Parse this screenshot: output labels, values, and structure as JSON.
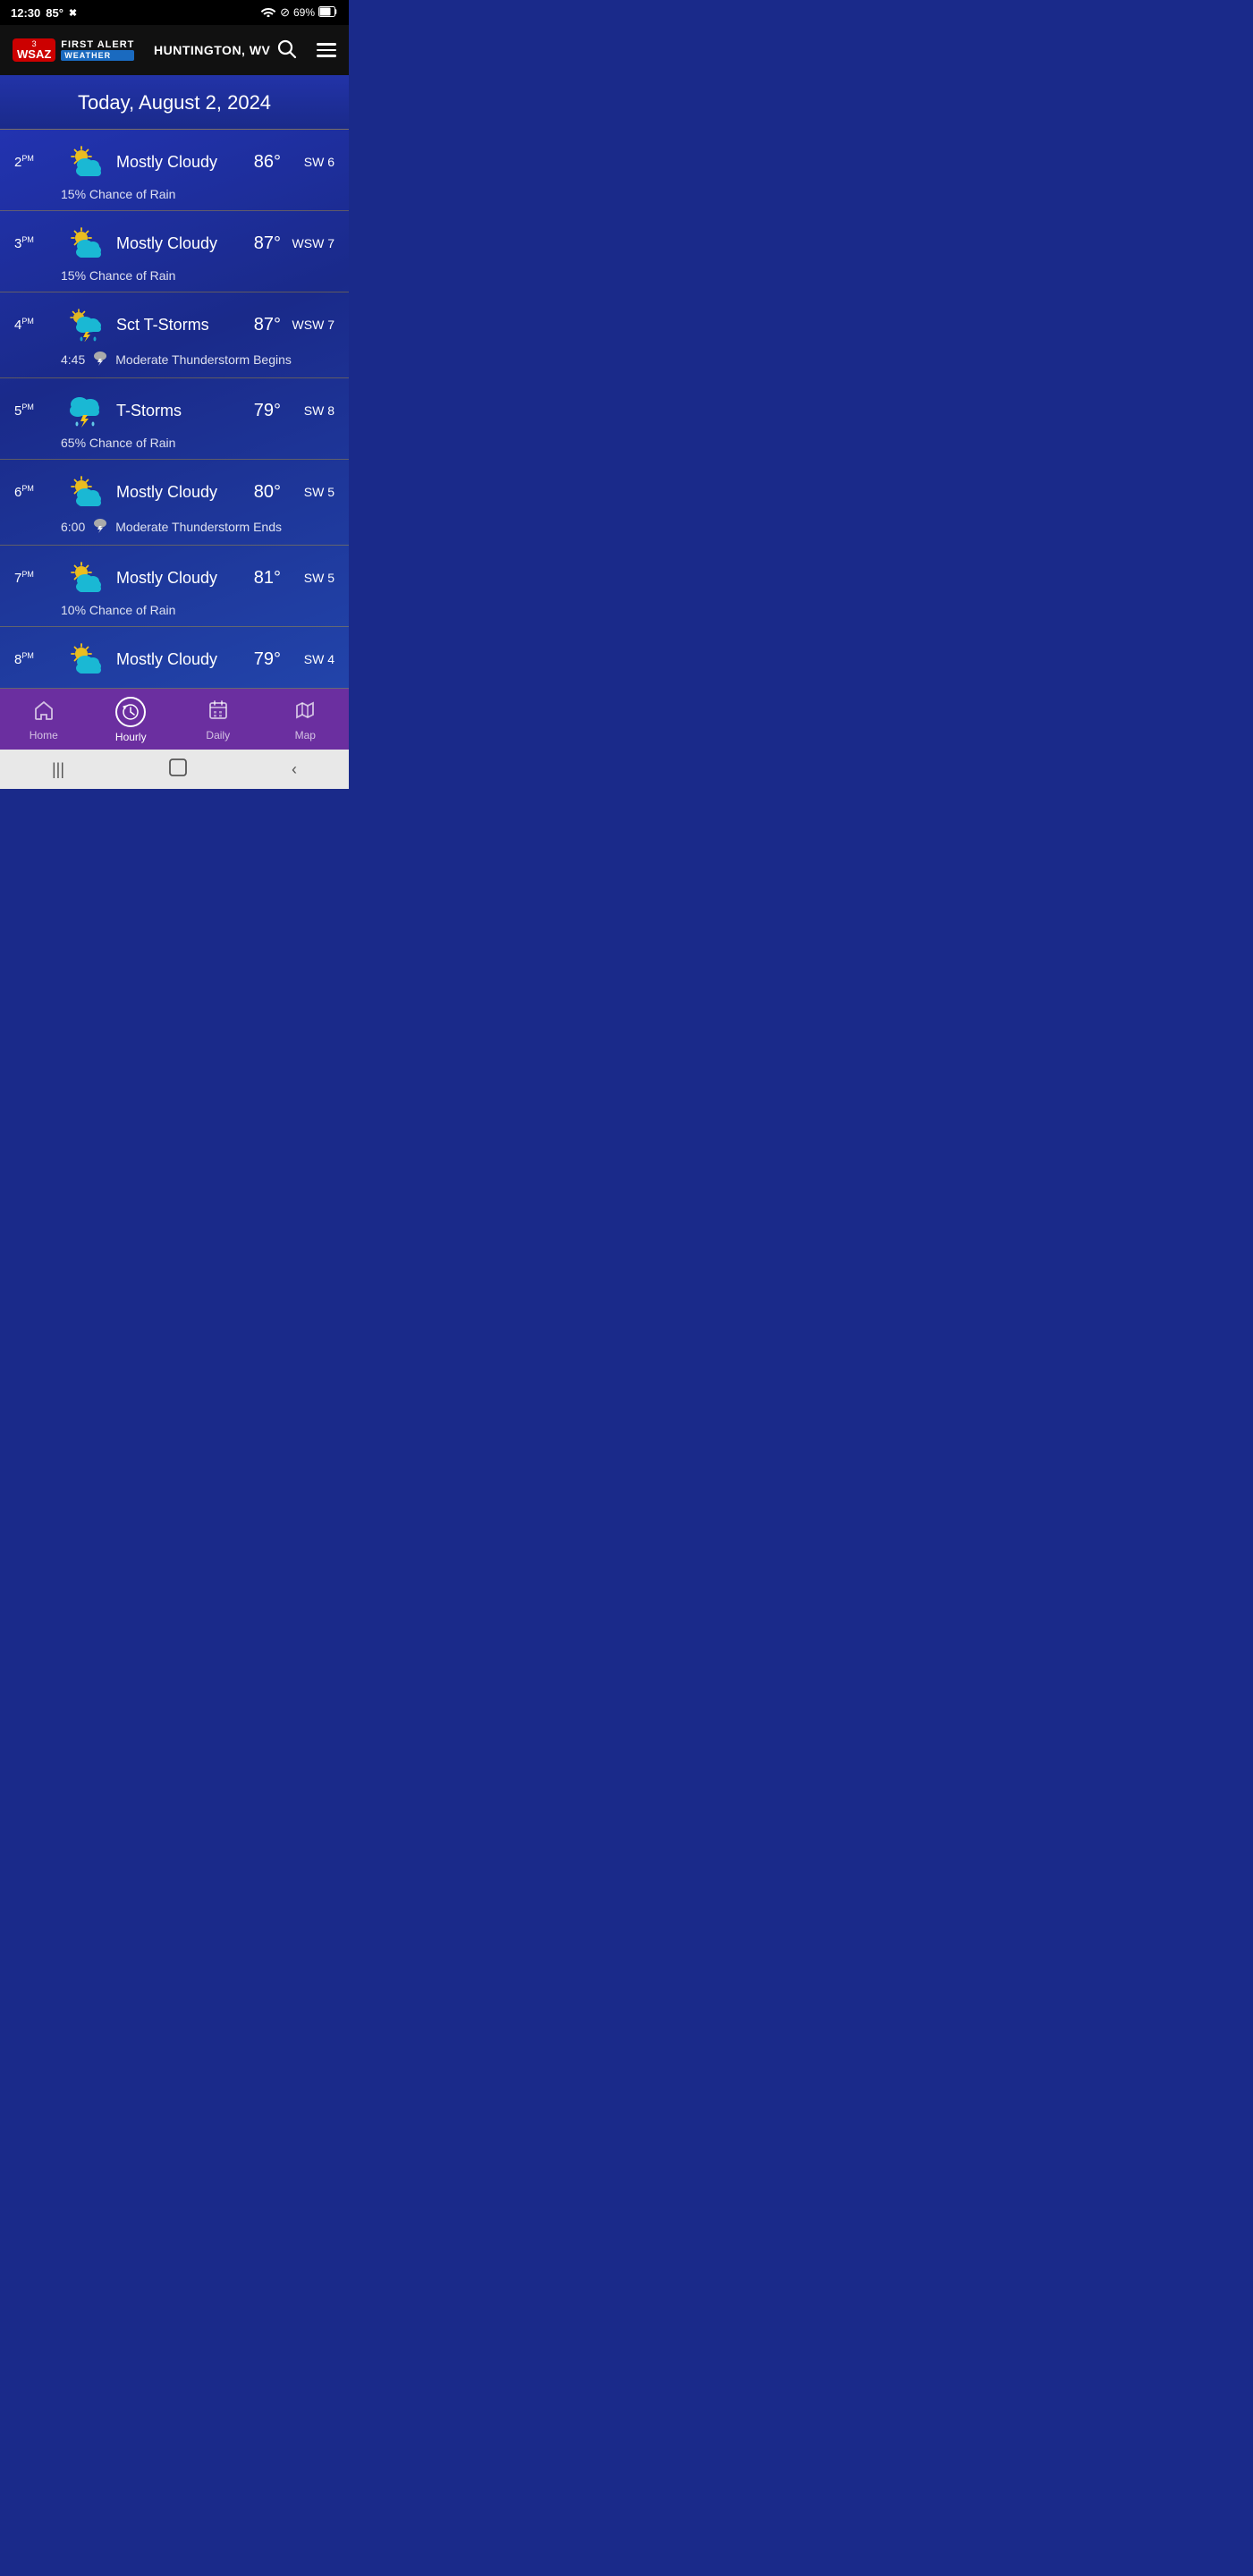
{
  "statusBar": {
    "time": "12:30",
    "temp": "85°",
    "battery": "69%",
    "wifiIcon": "wifi",
    "batteryIcon": "🔋"
  },
  "header": {
    "logo": {
      "channel": "3",
      "station": "WSAZ",
      "firstAlert": "FIRST ALERT",
      "weather": "WEATHER"
    },
    "location": "HUNTINGTON, WV",
    "searchLabel": "search",
    "menuLabel": "menu"
  },
  "dateBanner": {
    "text": "Today, August 2, 2024"
  },
  "hourlyRows": [
    {
      "time": "2",
      "period": "PM",
      "icon": "mostly-cloudy-sun",
      "condition": "Mostly Cloudy",
      "temp": "86°",
      "wind": "SW 6",
      "sub": "15% Chance of Rain",
      "subTime": null,
      "subIcon": null
    },
    {
      "time": "3",
      "period": "PM",
      "icon": "mostly-cloudy-sun",
      "condition": "Mostly Cloudy",
      "temp": "87°",
      "wind": "WSW 7",
      "sub": "15% Chance of Rain",
      "subTime": null,
      "subIcon": null
    },
    {
      "time": "4",
      "period": "PM",
      "icon": "tstorm-sun",
      "condition": "Sct T-Storms",
      "temp": "87°",
      "wind": "WSW 7",
      "sub": "Moderate Thunderstorm Begins",
      "subTime": "4:45",
      "subIcon": "thunderstorm"
    },
    {
      "time": "5",
      "period": "PM",
      "icon": "tstorm",
      "condition": "T-Storms",
      "temp": "79°",
      "wind": "SW 8",
      "sub": "65% Chance of Rain",
      "subTime": null,
      "subIcon": null
    },
    {
      "time": "6",
      "period": "PM",
      "icon": "mostly-cloudy-sun",
      "condition": "Mostly Cloudy",
      "temp": "80°",
      "wind": "SW 5",
      "sub": "Moderate Thunderstorm Ends",
      "subTime": "6:00",
      "subIcon": "thunderstorm"
    },
    {
      "time": "7",
      "period": "PM",
      "icon": "mostly-cloudy-sun",
      "condition": "Mostly Cloudy",
      "temp": "81°",
      "wind": "SW 5",
      "sub": "10% Chance of Rain",
      "subTime": null,
      "subIcon": null
    },
    {
      "time": "8",
      "period": "PM",
      "icon": "mostly-cloudy-sun",
      "condition": "Mostly Cloudy",
      "temp": "79°",
      "wind": "SW 4",
      "sub": null,
      "subTime": null,
      "subIcon": null
    }
  ],
  "bottomNav": {
    "items": [
      {
        "id": "home",
        "label": "Home",
        "icon": "home",
        "active": false
      },
      {
        "id": "hourly",
        "label": "Hourly",
        "icon": "back-clock",
        "active": true
      },
      {
        "id": "daily",
        "label": "Daily",
        "icon": "calendar",
        "active": false
      },
      {
        "id": "map",
        "label": "Map",
        "icon": "map",
        "active": false
      }
    ]
  }
}
